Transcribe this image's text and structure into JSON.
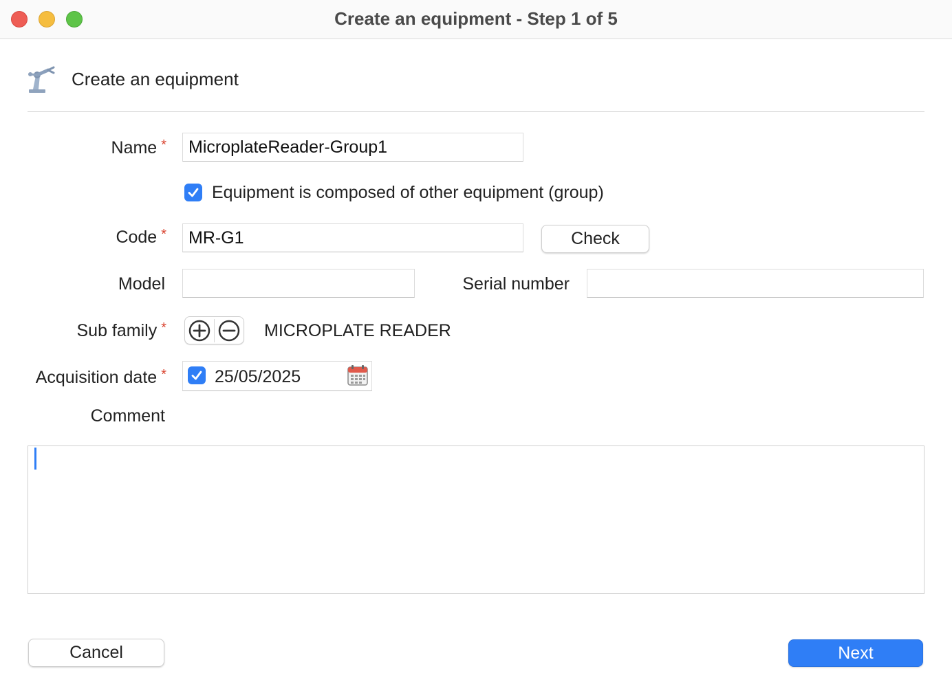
{
  "window": {
    "title": "Create an equipment - Step 1 of 5"
  },
  "header": {
    "title": "Create an equipment",
    "icon": "robotic-arm-icon"
  },
  "form": {
    "name": {
      "label": "Name",
      "value": "MicroplateReader-Group1",
      "required_mark": "*"
    },
    "group_checkbox": {
      "label": "Equipment is composed of other equipment (group)",
      "checked": true
    },
    "code": {
      "label": "Code",
      "value": "MR-G1",
      "required_mark": "*",
      "check_button": "Check"
    },
    "model": {
      "label": "Model",
      "value": ""
    },
    "serial_number": {
      "label": "Serial number",
      "value": ""
    },
    "sub_family": {
      "label": "Sub family",
      "value": "MICROPLATE READER",
      "required_mark": "*",
      "add_icon": "plus-circle-icon",
      "remove_icon": "minus-circle-icon"
    },
    "acquisition_date": {
      "label": "Acquisition date",
      "value": "25/05/2025",
      "required_mark": "*",
      "checked": true,
      "icon": "calendar-icon"
    },
    "comment": {
      "label": "Comment",
      "value": ""
    }
  },
  "footer": {
    "cancel_label": "Cancel",
    "next_label": "Next"
  },
  "colors": {
    "accent": "#2f7ef6",
    "required": "#d9432f"
  }
}
